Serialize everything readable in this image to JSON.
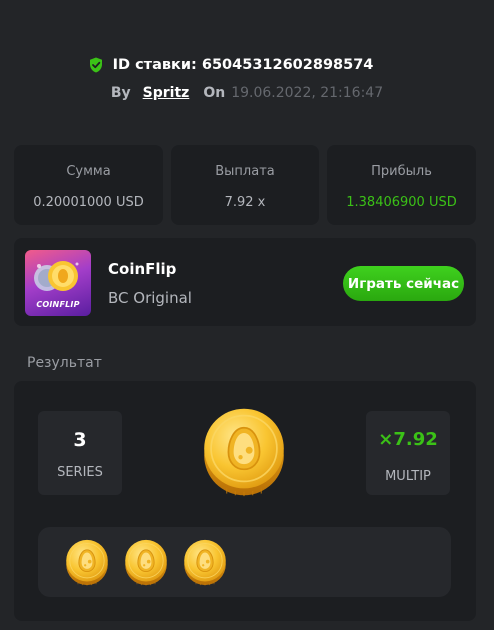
{
  "header": {
    "bet_id_label": "ID ставки: 65045312602898574",
    "by_label": "By",
    "player": "Spritz",
    "on_label": "On",
    "datetime": "19.06.2022, 21:16:47",
    "verified_icon": "shield-check-icon",
    "verified_color": "#3bc117"
  },
  "stats": [
    {
      "title": "Сумма",
      "value": "0.20001000 USD"
    },
    {
      "title": "Выплата",
      "value": "7.92 x"
    },
    {
      "title": "Прибыль",
      "value": "1.38406900 USD",
      "color": "#3bc117"
    }
  ],
  "game": {
    "thumbnail_label": "COINFLIP",
    "name": "CoinFlip",
    "provider": "BC Original",
    "play_button": "Играть сейчас",
    "button_color": "#3bc117"
  },
  "result": {
    "title": "Результат",
    "series_value": "3",
    "series_label": "SERIES",
    "multiplier_value": "×7.92",
    "multiplier_label": "MULTIP",
    "big_coin_icon": "gold-coin-icon",
    "coins": [
      "gold-coin-icon",
      "gold-coin-icon",
      "gold-coin-icon"
    ]
  }
}
